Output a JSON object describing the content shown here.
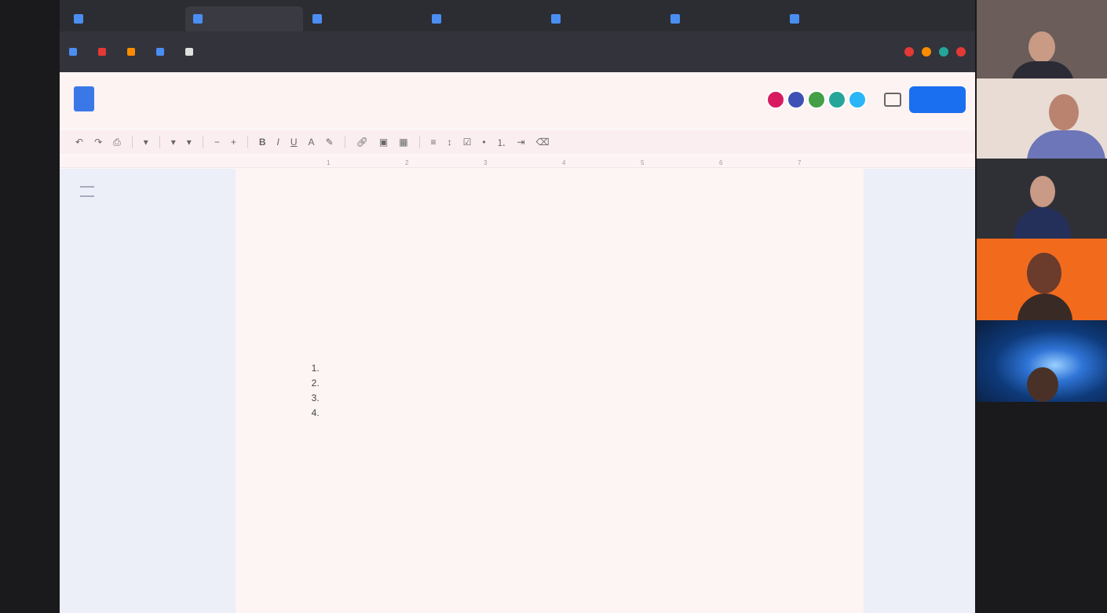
{
  "browser": {
    "tabs": [
      {
        "label": "",
        "active": false
      },
      {
        "label": "",
        "active": true
      },
      {
        "label": "",
        "active": false
      },
      {
        "label": "",
        "active": false
      },
      {
        "label": "",
        "active": false
      },
      {
        "label": "",
        "active": false
      },
      {
        "label": "",
        "active": false
      }
    ],
    "bookmarks": [
      {
        "label": "",
        "color": "#4a8ef2"
      },
      {
        "label": "",
        "color": "#e53935"
      },
      {
        "label": "",
        "color": "#fb8c00"
      },
      {
        "label": "",
        "color": "#4a8ef2"
      },
      {
        "label": "",
        "color": "#e0e0e0"
      }
    ],
    "extension_colors": [
      "#e53935",
      "#fb8c00",
      "#26a69a",
      "#e53935"
    ]
  },
  "docs": {
    "title": "",
    "menu": [
      "",
      "",
      "",
      "",
      "",
      "",
      "",
      ""
    ],
    "share_label": "",
    "collaborator_colors": [
      "#d81b60",
      "#3f51b5",
      "#43a047",
      "#26a69a",
      "#29b6f6"
    ],
    "ruler_ticks": [
      "1",
      "2",
      "3",
      "4",
      "5",
      "6",
      "7"
    ]
  },
  "document": {
    "heading": "",
    "list_items": [
      "",
      "",
      "",
      ""
    ]
  },
  "colors": {
    "accent": "#1a6ef0",
    "tile_orange": "#f26b1d",
    "tile_blue": "#0e3a7a"
  }
}
